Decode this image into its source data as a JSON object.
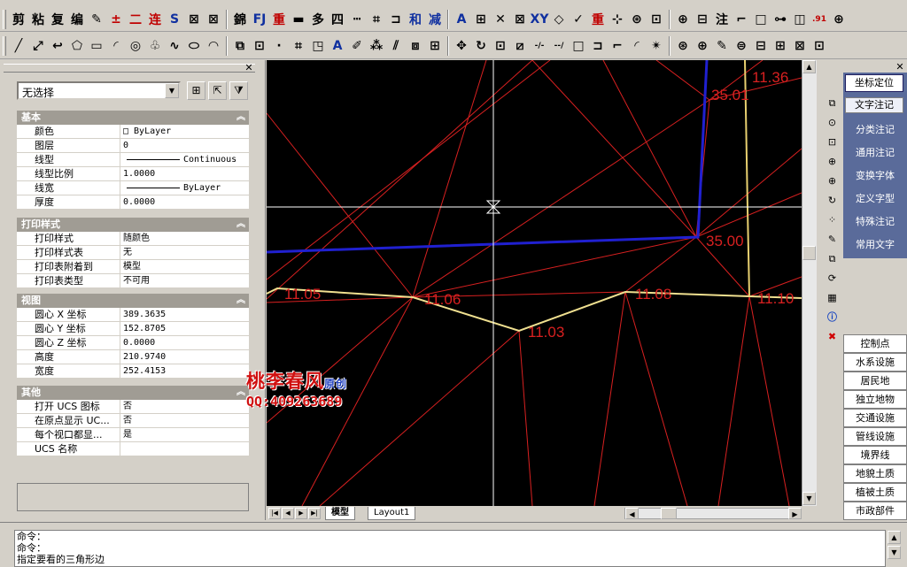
{
  "toolbar1": {
    "items": [
      {
        "label": "剪",
        "icon": "cut-icon"
      },
      {
        "label": "粘",
        "icon": "paste-icon"
      },
      {
        "label": "复",
        "icon": "copy-icon"
      },
      {
        "label": "编",
        "icon": "edit-icon"
      },
      {
        "label": "✎",
        "icon": "pen-icon"
      },
      {
        "label": "±",
        "icon": "plusminus-icon"
      },
      {
        "label": "二",
        "icon": "double-line-icon"
      },
      {
        "label": "连",
        "icon": "connect-icon"
      },
      {
        "label": "S",
        "icon": "curve-s-icon"
      },
      {
        "label": "⊠",
        "icon": "grid-icon"
      },
      {
        "label": "⊠",
        "icon": "cross-box-icon"
      },
      {
        "label": "錦",
        "icon": "fill-icon"
      },
      {
        "label": "FJ",
        "icon": "fj-icon"
      },
      {
        "label": "重",
        "icon": "redo-icon"
      },
      {
        "label": "▬",
        "icon": "bar-icon"
      },
      {
        "label": "多",
        "icon": "multi-icon"
      },
      {
        "label": "四",
        "icon": "four-icon"
      },
      {
        "label": "┅",
        "icon": "dash-icon"
      },
      {
        "label": "⌗",
        "icon": "hatch-icon"
      },
      {
        "label": "⊐",
        "icon": "bracket-icon"
      },
      {
        "label": "和",
        "icon": "sum-icon"
      },
      {
        "label": "减",
        "icon": "minus-icon"
      },
      {
        "label": "A",
        "icon": "text-icon"
      },
      {
        "label": "⊞",
        "icon": "table-icon"
      },
      {
        "label": "✕",
        "icon": "delete-icon"
      },
      {
        "label": "⊠",
        "icon": "box-x-icon"
      },
      {
        "label": "XY",
        "icon": "xy-icon"
      },
      {
        "label": "◇",
        "icon": "node-icon"
      },
      {
        "label": "✓",
        "icon": "check-icon"
      },
      {
        "label": "重",
        "icon": "repeat-icon"
      },
      {
        "label": "⊹",
        "icon": "point-icon"
      },
      {
        "label": "⊛",
        "icon": "snap-icon"
      },
      {
        "label": "⊡",
        "icon": "frame-icon"
      },
      {
        "label": "⊕",
        "icon": "add-icon"
      },
      {
        "label": "⊟",
        "icon": "collapse-icon"
      },
      {
        "label": "注",
        "icon": "annotate-icon"
      },
      {
        "label": "⌐",
        "icon": "corner-icon"
      },
      {
        "label": "□",
        "icon": "rect-icon"
      },
      {
        "label": "⊶",
        "icon": "link-icon"
      },
      {
        "label": "◫",
        "icon": "window-icon"
      },
      {
        "label": ".91",
        "icon": "decimal-icon"
      },
      {
        "label": "⊕",
        "icon": "circle-plus-icon"
      }
    ]
  },
  "toolbar2": {
    "items": [
      {
        "label": "╱",
        "icon": "line-icon"
      },
      {
        "label": "⤢",
        "icon": "polyline-icon"
      },
      {
        "label": "↩",
        "icon": "arc-back-icon"
      },
      {
        "label": "⬠",
        "icon": "polygon-icon"
      },
      {
        "label": "▭",
        "icon": "rectangle-icon"
      },
      {
        "label": "◜",
        "icon": "arc-icon"
      },
      {
        "label": "◎",
        "icon": "circle-icon"
      },
      {
        "label": "♧",
        "icon": "cloud-icon"
      },
      {
        "label": "∿",
        "icon": "spline-icon"
      },
      {
        "label": "⬭",
        "icon": "ellipse-icon"
      },
      {
        "label": "◠",
        "icon": "ellipse-arc-icon"
      },
      {
        "label": "⧉",
        "icon": "insert-block-icon"
      },
      {
        "label": "⊡",
        "icon": "make-block-icon"
      },
      {
        "label": "·",
        "icon": "point-icon"
      },
      {
        "label": "⌗",
        "icon": "hatch-icon"
      },
      {
        "label": "◳",
        "icon": "region-icon"
      },
      {
        "label": "A",
        "icon": "mtext-icon"
      },
      {
        "label": "✐",
        "icon": "erase-icon"
      },
      {
        "label": "⁂",
        "icon": "copy-object-icon"
      },
      {
        "label": "⫽",
        "icon": "mirror-icon"
      },
      {
        "label": "⧈",
        "icon": "offset-icon"
      },
      {
        "label": "⊞",
        "icon": "array-icon"
      },
      {
        "label": "✥",
        "icon": "move-icon"
      },
      {
        "label": "↻",
        "icon": "rotate-icon"
      },
      {
        "label": "⊡",
        "icon": "scale-icon"
      },
      {
        "label": "⧄",
        "icon": "stretch-icon"
      },
      {
        "label": "-/-",
        "icon": "trim-icon"
      },
      {
        "label": "--/",
        "icon": "extend-icon"
      },
      {
        "label": "□",
        "icon": "break-icon"
      },
      {
        "label": "⊐",
        "icon": "join-icon"
      },
      {
        "label": "⌐",
        "icon": "chamfer-icon"
      },
      {
        "label": "◜",
        "icon": "fillet-icon"
      },
      {
        "label": "✴",
        "icon": "explode-icon"
      },
      {
        "label": "⊛",
        "icon": "tool-a-icon"
      },
      {
        "label": "⊕",
        "icon": "zoom-in-icon"
      },
      {
        "label": "✎",
        "icon": "tool-b-icon"
      },
      {
        "label": "⊜",
        "icon": "tool-c-icon"
      },
      {
        "label": "⊟",
        "icon": "tool-d-icon"
      },
      {
        "label": "⊞",
        "icon": "tool-e-icon"
      },
      {
        "label": "⊠",
        "icon": "tool-f-icon"
      },
      {
        "label": "⊡",
        "icon": "tool-g-icon"
      }
    ]
  },
  "properties": {
    "selection": "无选择",
    "sections": [
      {
        "title": "基本",
        "rows": [
          {
            "key": "颜色",
            "value": "□ ByLayer"
          },
          {
            "key": "图层",
            "value": "0"
          },
          {
            "key": "线型",
            "value": "Continuous",
            "linetype": true
          },
          {
            "key": "线型比例",
            "value": "1.0000"
          },
          {
            "key": "线宽",
            "value": "ByLayer",
            "linetype": true
          },
          {
            "key": "厚度",
            "value": "0.0000"
          }
        ]
      },
      {
        "title": "打印样式",
        "rows": [
          {
            "key": "打印样式",
            "value": "随颜色"
          },
          {
            "key": "打印样式表",
            "value": "无"
          },
          {
            "key": "打印表附着到",
            "value": "模型"
          },
          {
            "key": "打印表类型",
            "value": "不可用"
          }
        ]
      },
      {
        "title": "视图",
        "rows": [
          {
            "key": "圆心 X 坐标",
            "value": "389.3635"
          },
          {
            "key": "圆心 Y 坐标",
            "value": "152.8705"
          },
          {
            "key": "圆心 Z 坐标",
            "value": "0.0000"
          },
          {
            "key": "高度",
            "value": "210.9740"
          },
          {
            "key": "宽度",
            "value": "252.4153"
          }
        ]
      },
      {
        "title": "其他",
        "rows": [
          {
            "key": "打开 UCS 图标",
            "value": "否"
          },
          {
            "key": "在原点显示 UC...",
            "value": "否"
          },
          {
            "key": "每个视口都显...",
            "value": "是"
          },
          {
            "key": "UCS 名称",
            "value": ""
          }
        ]
      }
    ]
  },
  "drawing": {
    "labels": [
      "11.36",
      "35.01",
      "35.00",
      "11.05",
      "11.06",
      "11.08",
      "11.10",
      "11.03"
    ]
  },
  "layout_tabs": {
    "model": "模型",
    "layout1": "Layout1"
  },
  "right_panel": {
    "top_commands": [
      {
        "label": "坐标定位",
        "state": "active"
      },
      {
        "label": "文字注记",
        "state": "sel"
      },
      {
        "label": "分类注记",
        "state": ""
      },
      {
        "label": "通用注记",
        "state": ""
      },
      {
        "label": "变换字体",
        "state": ""
      },
      {
        "label": "定义字型",
        "state": ""
      },
      {
        "label": "特殊注记",
        "state": ""
      },
      {
        "label": "常用文字",
        "state": ""
      }
    ],
    "categories": [
      "控制点",
      "水系设施",
      "居民地",
      "独立地物",
      "交通设施",
      "管线设施",
      "境界线",
      "地貌土质",
      "植被土质",
      "市政部件"
    ]
  },
  "command_line": {
    "lines": [
      "命令：",
      "命令：",
      "指定要看的三角形边"
    ]
  },
  "watermark": {
    "line1": "桃李春风",
    "line1_suffix": "原创",
    "line2": "QQ:409263689"
  },
  "colors": {
    "canvas": "#000000",
    "triangle_lines": "#d82020",
    "contour_line": "#e8d070",
    "boundary_blue": "#2020d0",
    "crosshair": "#ffffff"
  }
}
